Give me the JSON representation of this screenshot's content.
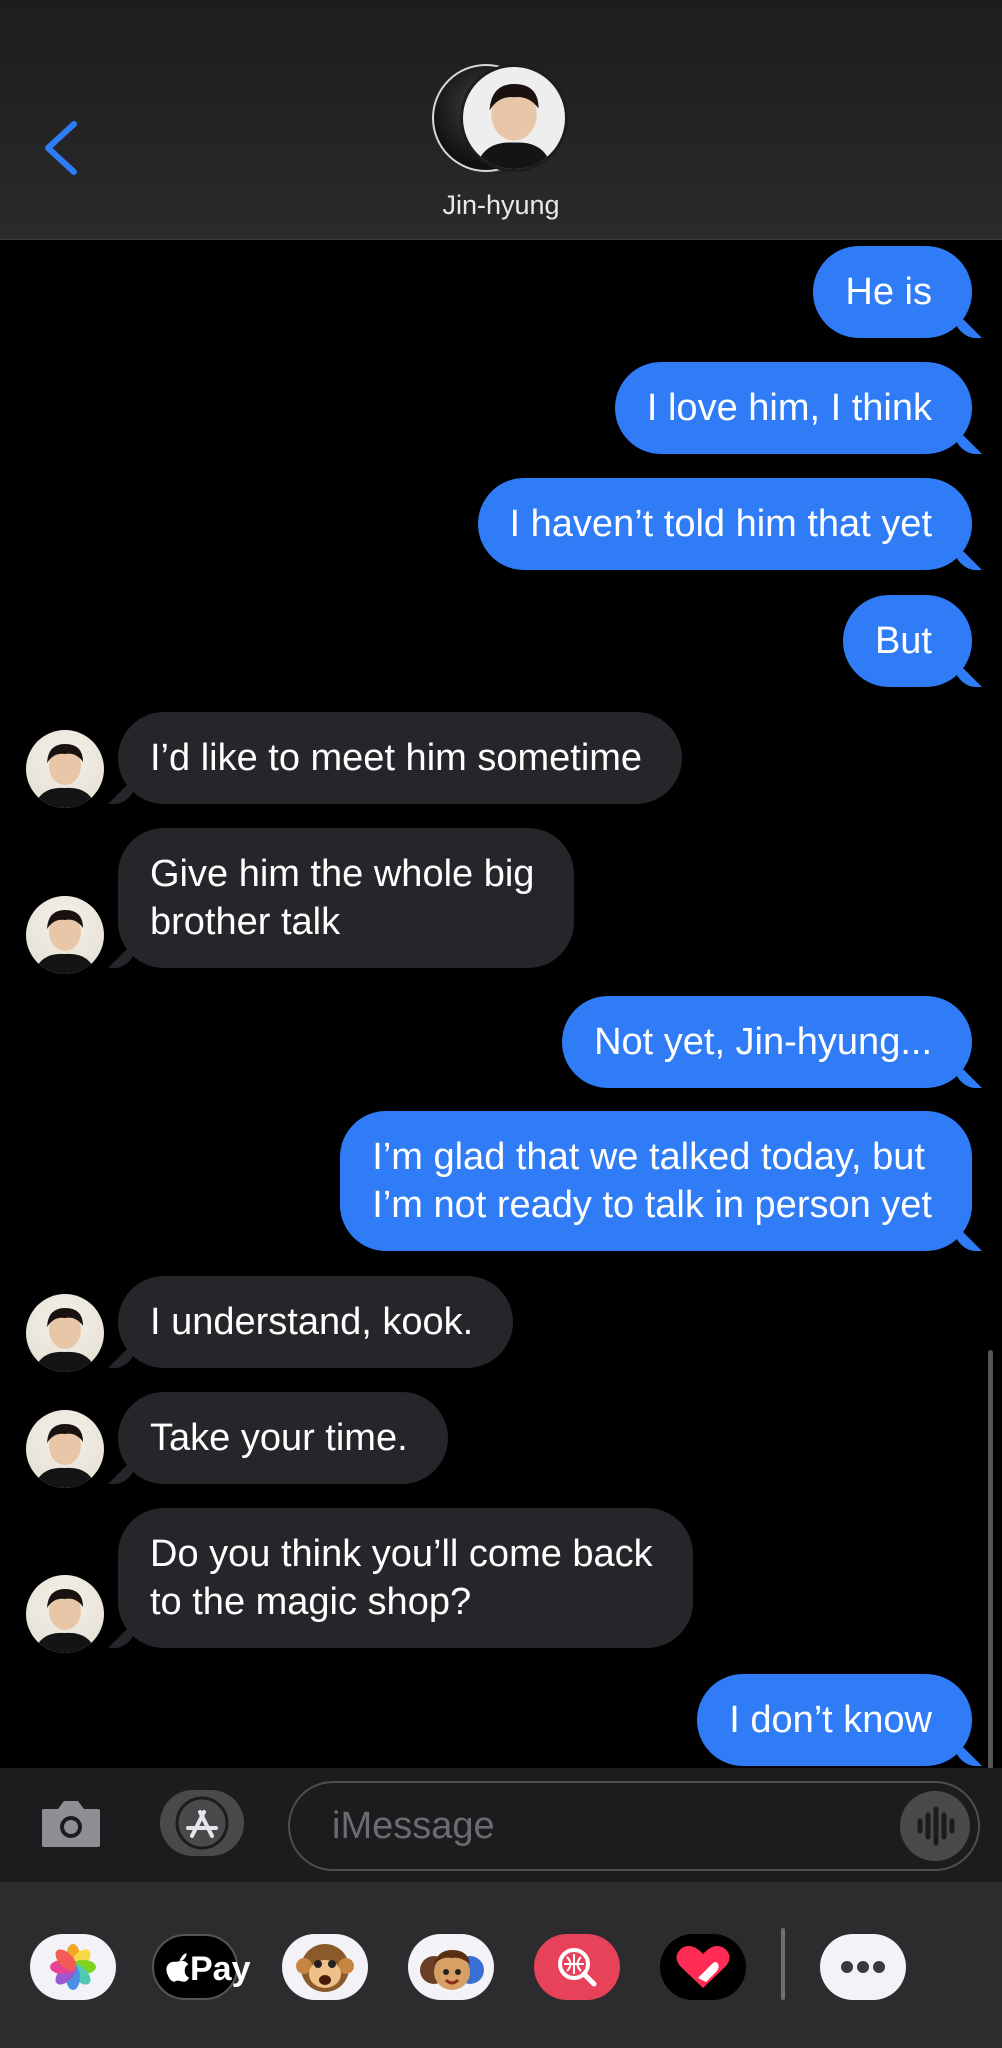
{
  "header": {
    "contact_name": "Jin-hyung"
  },
  "messages": [
    {
      "dir": "sent",
      "lines": [
        "He is"
      ]
    },
    {
      "dir": "sent",
      "lines": [
        "I love him, I think"
      ]
    },
    {
      "dir": "sent",
      "lines": [
        "I haven’t told him that yet"
      ]
    },
    {
      "dir": "sent",
      "lines": [
        "But"
      ]
    },
    {
      "dir": "recv",
      "lines": [
        "I’d like to meet him sometime"
      ]
    },
    {
      "dir": "recv",
      "lines": [
        "Give him the whole big",
        "brother talk"
      ]
    },
    {
      "dir": "sent",
      "lines": [
        "Not yet, Jin-hyung..."
      ]
    },
    {
      "dir": "sent",
      "lines": [
        "I’m glad that we talked today, but",
        "I’m not ready to talk in person yet"
      ]
    },
    {
      "dir": "recv",
      "lines": [
        "I understand, kook."
      ]
    },
    {
      "dir": "recv",
      "lines": [
        "Take your time."
      ]
    },
    {
      "dir": "recv",
      "lines": [
        "Do you think you’ll come back",
        "to the magic shop?"
      ]
    },
    {
      "dir": "sent",
      "lines": [
        "I don’t know"
      ]
    }
  ],
  "compose": {
    "placeholder": "iMessage"
  },
  "drawer": {
    "apple_pay_label": "Pay",
    "apps": [
      "photos-icon",
      "apple-pay-icon",
      "animoji-icon",
      "memoji-icon",
      "image-search-icon",
      "digital-touch-icon",
      "more-icon"
    ]
  },
  "colors": {
    "sent_bubble": "#2f7cf6",
    "received_bubble": "#26262a",
    "accent": "#2f7cf6"
  }
}
